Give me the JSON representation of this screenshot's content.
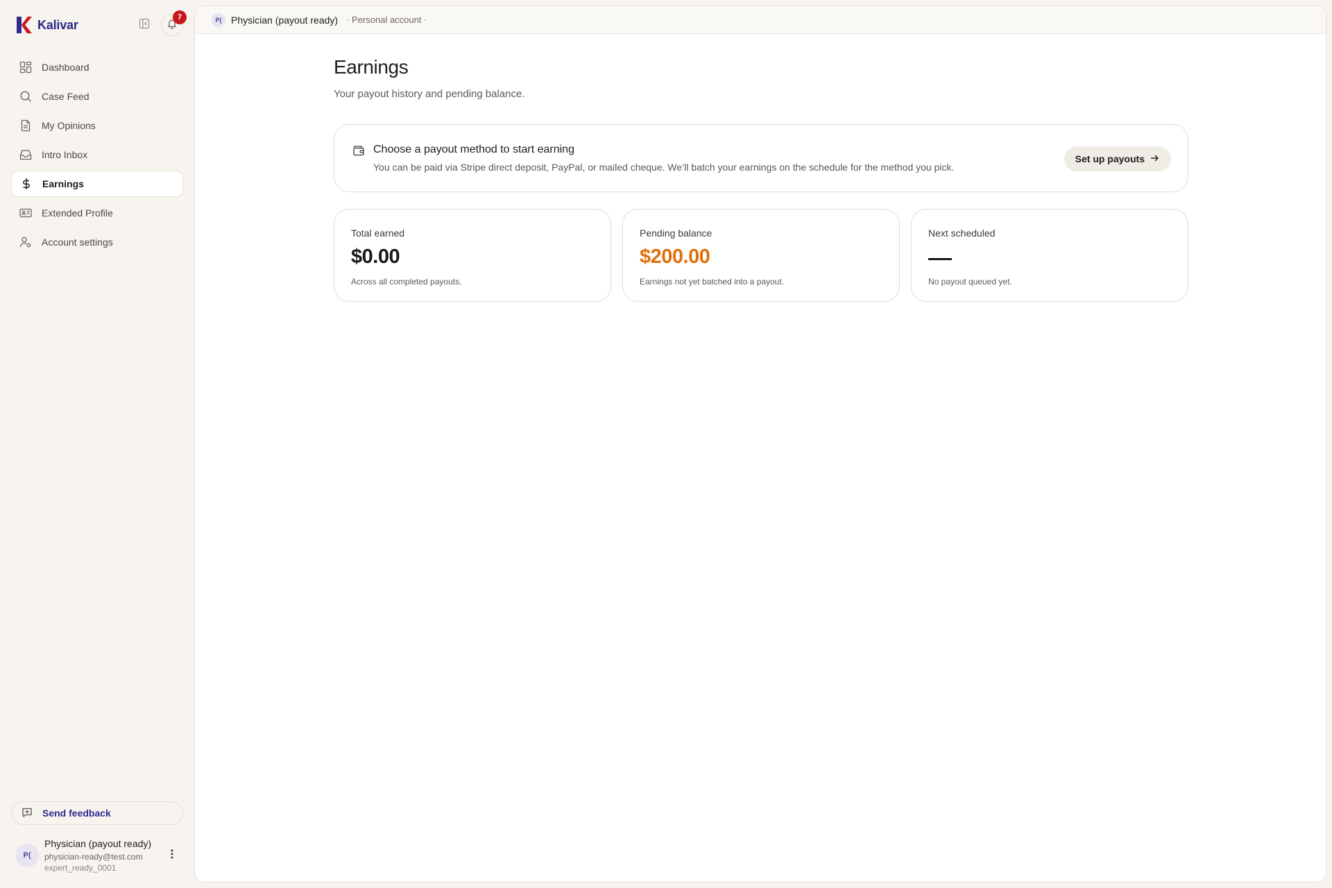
{
  "brand": {
    "name": "Kalivar",
    "color": "#2d2a8c",
    "mark_color": "#c8151b"
  },
  "notifications": {
    "count": "7"
  },
  "nav": {
    "items": [
      {
        "label": "Dashboard",
        "icon": "dashboard-icon"
      },
      {
        "label": "Case Feed",
        "icon": "search-icon"
      },
      {
        "label": "My Opinions",
        "icon": "document-icon"
      },
      {
        "label": "Intro Inbox",
        "icon": "inbox-icon"
      },
      {
        "label": "Earnings",
        "icon": "dollar-icon",
        "active": true
      },
      {
        "label": "Extended Profile",
        "icon": "id-card-icon"
      },
      {
        "label": "Account settings",
        "icon": "user-settings-icon"
      }
    ]
  },
  "feedback": {
    "label": "Send feedback"
  },
  "user": {
    "initials": "P(",
    "name": "Physician (payout ready)",
    "email": "physician-ready@test.com",
    "id": "expert_ready_0001"
  },
  "topbar": {
    "initials": "P(",
    "name": "Physician (payout ready)",
    "account_type": "· Personal account ·"
  },
  "page": {
    "title": "Earnings",
    "subtitle": "Your payout history and pending balance."
  },
  "banner": {
    "title": "Choose a payout method to start earning",
    "description": "You can be paid via Stripe direct deposit, PayPal, or mailed cheque. We’ll batch your earnings on the schedule for the method you pick.",
    "button_label": "Set up payouts"
  },
  "stats": {
    "total": {
      "label": "Total earned",
      "value": "$0.00",
      "note": "Across all completed payouts."
    },
    "pending": {
      "label": "Pending balance",
      "value": "$200.00",
      "note": "Earnings not yet batched into a payout.",
      "color": "#e06f0a"
    },
    "next": {
      "label": "Next scheduled",
      "note": "No payout queued yet."
    }
  }
}
